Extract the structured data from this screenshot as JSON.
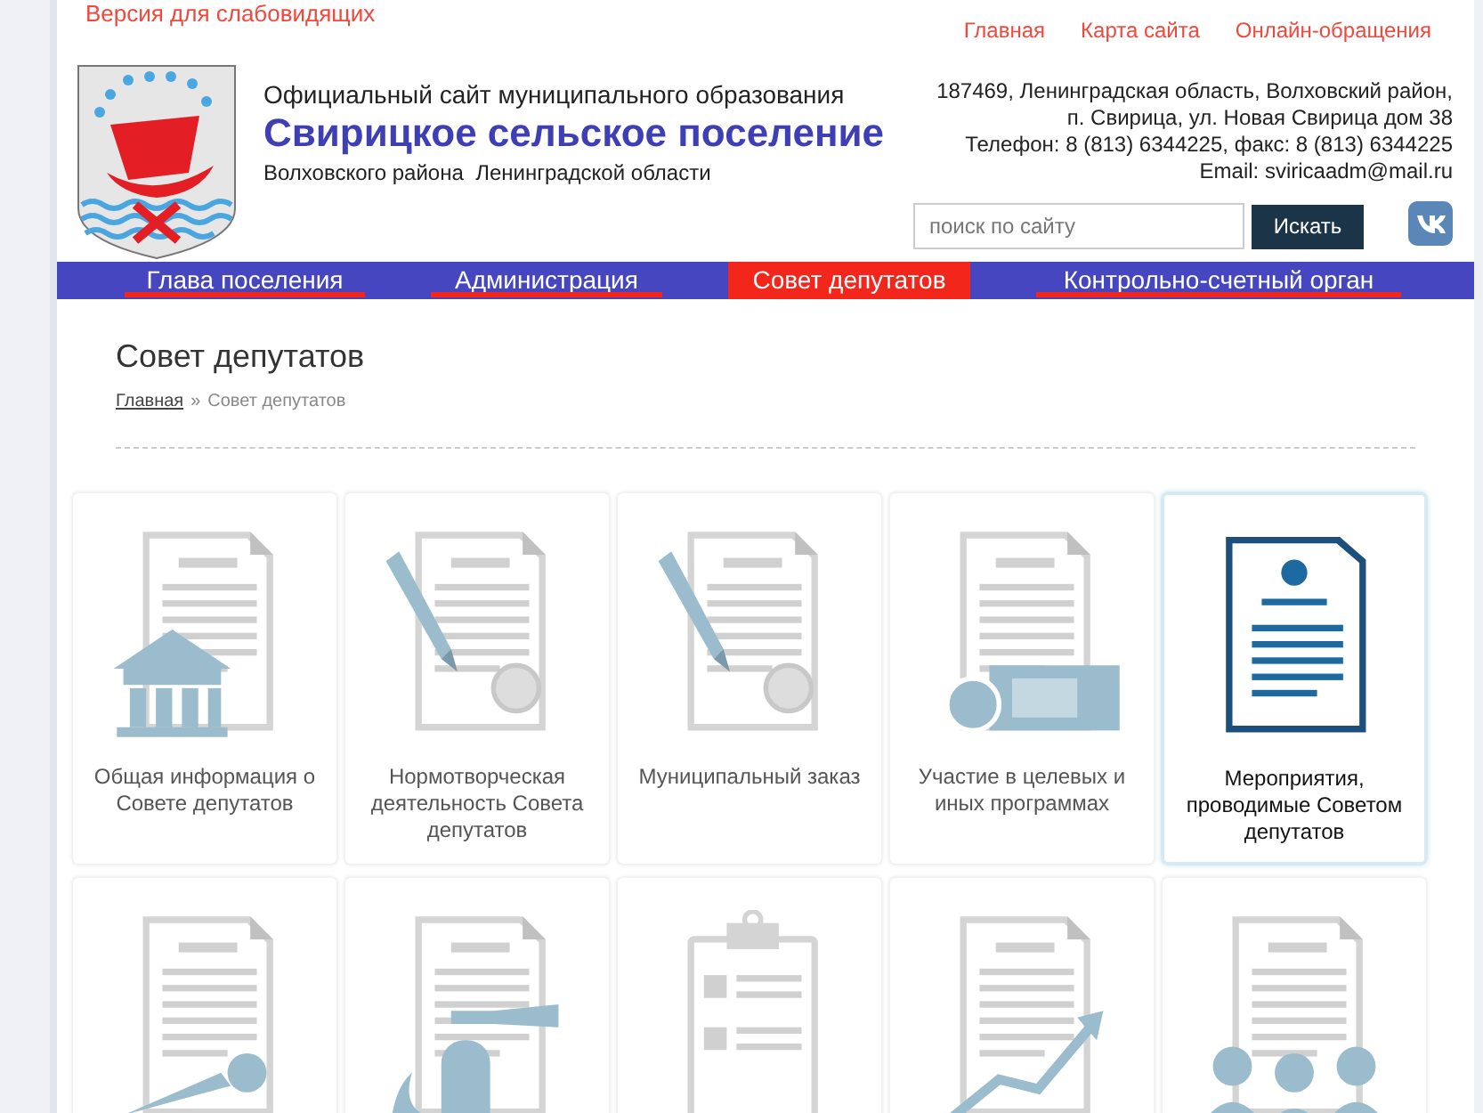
{
  "top_bar": {
    "accessibility_link": "Версия для слабовидящих",
    "links": [
      "Главная",
      "Карта сайта",
      "Онлайн-обращения"
    ]
  },
  "header": {
    "subtitle": "Официальный сайт муниципального образования",
    "title": "Свирицкое сельское поселение",
    "region": "Волховского района  Ленинградской области",
    "contacts": [
      "187469, Ленинградская область, Волховский район,",
      "п. Свирица, ул. Новая Свирица дом 38",
      "Телефон: 8 (813) 6344225, факс: 8 (813) 6344225",
      "Email: sviricaadm@mail.ru"
    ],
    "search": {
      "placeholder": "поиск по сайту",
      "button": "Искать"
    }
  },
  "nav": [
    {
      "label": "Глава поселения",
      "selected": false
    },
    {
      "label": "Администрация",
      "selected": false
    },
    {
      "label": "Совет депутатов",
      "selected": true
    },
    {
      "label": "Контрольно-счетный орган",
      "selected": false
    }
  ],
  "page": {
    "title": "Совет депутатов",
    "breadcrumbs": [
      "Главная",
      "»",
      "Совет депутатов"
    ]
  },
  "tiles": [
    {
      "kind": "building",
      "caption": "Общая информация о Совете депутатов",
      "highlighted": false
    },
    {
      "kind": "pen-seal",
      "caption": "Нормотворческая деятельность Совета депутатов",
      "highlighted": false
    },
    {
      "kind": "pen-seal",
      "caption": "Муниципальный заказ",
      "highlighted": false
    },
    {
      "kind": "money",
      "caption": "Участие в целевых и иных программах",
      "highlighted": false
    },
    {
      "kind": "decree",
      "caption": "Мероприятия, проводимые Советом депутатов",
      "highlighted": true
    },
    {
      "kind": "microphone",
      "highlighted": false
    },
    {
      "kind": "extinguisher",
      "highlighted": false
    },
    {
      "kind": "checklist",
      "highlighted": false
    },
    {
      "kind": "chart",
      "highlighted": false
    },
    {
      "kind": "people",
      "highlighted": false
    }
  ]
}
